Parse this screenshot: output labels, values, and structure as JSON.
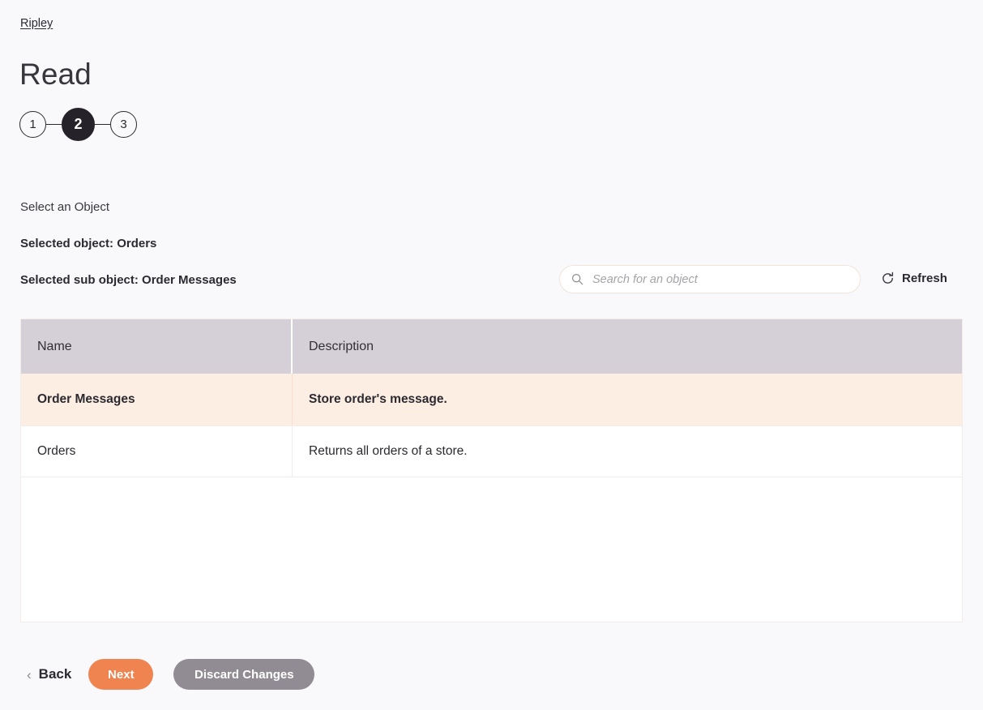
{
  "breadcrumb": {
    "label": "Ripley"
  },
  "header": {
    "title": "Read"
  },
  "stepper": {
    "steps": [
      {
        "label": "1",
        "state": "inactive"
      },
      {
        "label": "2",
        "state": "active"
      },
      {
        "label": "3",
        "state": "inactive"
      }
    ]
  },
  "selection": {
    "prompt": "Select an Object",
    "object_line": "Selected object: Orders",
    "sub_object_line": "Selected sub object: Order Messages"
  },
  "search": {
    "placeholder": "Search for an object",
    "value": "",
    "icon": "search-icon"
  },
  "refresh": {
    "label": "Refresh",
    "icon": "refresh-icon"
  },
  "table": {
    "columns": [
      "Name",
      "Description"
    ],
    "rows": [
      {
        "name": "Order Messages",
        "description": "Store order's message.",
        "selected": true
      },
      {
        "name": "Orders",
        "description": "Returns all orders of a store.",
        "selected": false
      }
    ]
  },
  "footer": {
    "back_label": "Back",
    "back_chevron": "‹",
    "next_label": "Next",
    "discard_label": "Discard Changes"
  },
  "colors": {
    "page_background": "#f9f9fb",
    "accent_orange": "#ef8450",
    "neutral_gray": "#918c93",
    "table_header": "#d5d0d8",
    "selected_row": "#fdeee4",
    "step_active": "#262229"
  }
}
